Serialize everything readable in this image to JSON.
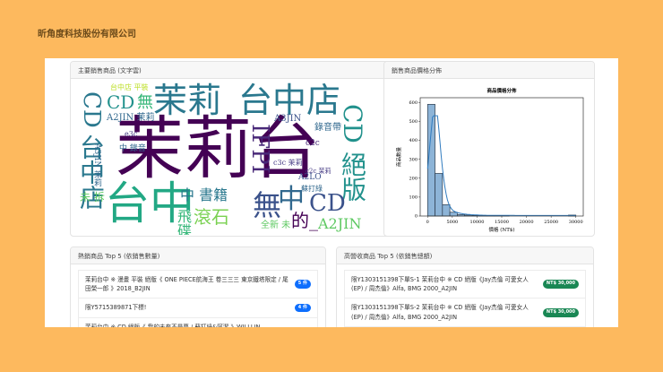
{
  "brand": "昕角度科技股份有限公司",
  "wordcloud": {
    "title": "主要銷售商品 (文字雲)",
    "words": [
      {
        "t": "茉莉台",
        "c": "#440154"
      },
      {
        "t": "台中",
        "c": "#22a884"
      },
      {
        "t": "台中店",
        "c": "#2a788e"
      },
      {
        "t": "CD",
        "c": "#2a788e"
      },
      {
        "t": "CD",
        "c": "#21918c"
      },
      {
        "t": "無",
        "c": "#35b779"
      },
      {
        "t": "茉莉",
        "c": "#2a788e"
      },
      {
        "t": "台中店",
        "c": "#2a788e"
      },
      {
        "t": "A2JIN 茉莉",
        "c": "#31688e"
      },
      {
        "t": "CD 絕版",
        "c": "#21918c"
      },
      {
        "t": "無",
        "c": "#3b528b"
      },
      {
        "t": "中",
        "c": "#31688e"
      },
      {
        "t": "CD",
        "c": "#3b528b"
      },
      {
        "t": "A2JIN",
        "c": "#5ec962"
      },
      {
        "t": "IFPI",
        "c": "#482878"
      },
      {
        "t": "的_",
        "c": "#440154"
      },
      {
        "t": "中 書籍",
        "c": "#2a788e"
      },
      {
        "t": "滾石",
        "c": "#7ad151"
      },
      {
        "t": "飛碟",
        "c": "#35b779"
      },
      {
        "t": "全新 未",
        "c": "#5ec962"
      },
      {
        "t": "蘇打綠",
        "c": "#31688e"
      },
      {
        "t": "錄音帶",
        "c": "#31688e"
      },
      {
        "t": "A3JIN",
        "c": "#3b528b"
      },
      {
        "t": "A3JIN 茉莉",
        "c": "#31688e"
      },
      {
        "t": "c2c 茉莉",
        "c": "#443983"
      },
      {
        "t": "c3c 茉莉",
        "c": "#443983"
      },
      {
        "t": "台中店 平裝",
        "c": "#bddf26"
      },
      {
        "t": "中 錄音",
        "c": "#31688e"
      },
      {
        "t": "未 拆",
        "c": "#5ec962"
      },
      {
        "t": "A2LO",
        "c": "#3b528b"
      },
      {
        "t": "c2c",
        "c": "#482878"
      },
      {
        "t": "e3c",
        "c": "#443983"
      }
    ]
  },
  "histogram": {
    "title": "銷售商品價格分佈"
  },
  "chart_data": {
    "type": "bar",
    "title": "商品價格分佈",
    "xlabel": "價格 (NT$)",
    "ylabel": "商品數量",
    "bin_width": 1500,
    "bin_starts": [
      0,
      1500,
      3000,
      4500,
      6000,
      7500,
      9000,
      10500,
      12000,
      13500,
      15000,
      28500
    ],
    "values": [
      590,
      225,
      60,
      20,
      8,
      5,
      3,
      2,
      1,
      1,
      1,
      5
    ],
    "xticks": [
      0,
      5000,
      10000,
      15000,
      20000,
      25000,
      30000
    ],
    "yticks": [
      0,
      100,
      200,
      300,
      400,
      500,
      600
    ],
    "xlim": [
      -1500,
      31500
    ],
    "ylim": [
      0,
      625
    ],
    "kde": true
  },
  "top_qty": {
    "title": "熱銷商品 Top 5 (依銷售數量)",
    "items": [
      {
        "name": "茉莉台中 ※ 漫畫 平裝 絕版《 ONE PIECE航海王 卷三三三 東京鐵塔限定 / 尾田榮一郎 》2018_B2JIN",
        "badge": "5 件"
      },
      {
        "name": "限Y5715389871下標!",
        "badge": "4 件"
      },
      {
        "name": "茉莉台中 ※ CD 絕版《 我的未來不是夢 / 蘇打綠&阿潔 》WILLLIN",
        "badge": ""
      }
    ]
  },
  "top_rev": {
    "title": "高營收商品 Top 5 (依銷售總額)",
    "items": [
      {
        "name": "限Y1303151398下單S-1 茉莉台中 ※ CD 絕版《Jay杰倫 可愛女人 (EP) / 周杰倫》Alfa, BMG 2000_A2JIN",
        "badge": "NT$ 30,000"
      },
      {
        "name": "限Y1303151398下單S-2 茉莉台中 ※ CD 絕版《Jay杰倫 可愛女人 (EP) / 周杰倫》Alfa, BMG 2000_A2JIN",
        "badge": "NT$ 30,000"
      }
    ]
  }
}
